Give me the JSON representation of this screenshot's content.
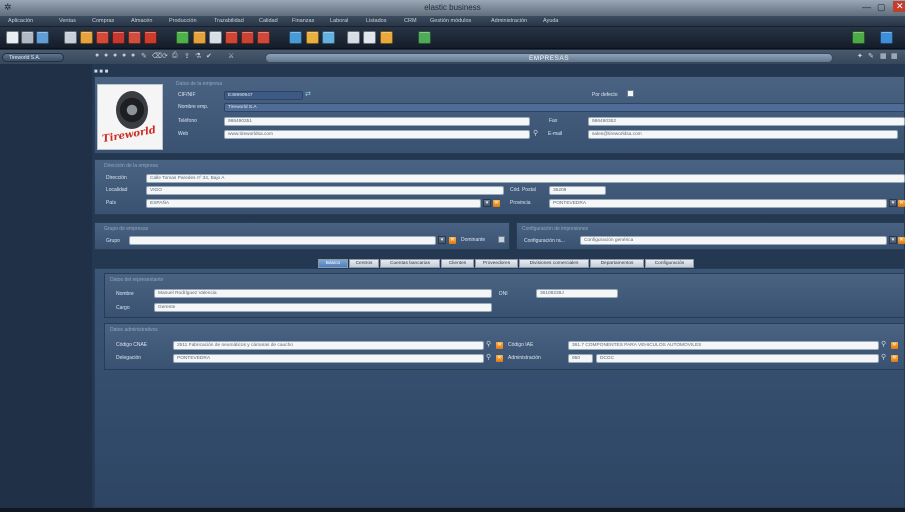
{
  "window": {
    "title": "elastic business"
  },
  "menu": [
    "Aplicación",
    "Ventas",
    "Compras",
    "Almacén",
    "Producción",
    "Trazabilidad",
    "Calidad",
    "Finanzas",
    "Laboral",
    "Listados",
    "CRM",
    "Gestión módulos",
    "Administración",
    "Ayuda"
  ],
  "open_tab": "Tireworld S.A.",
  "section_title": "EMPRESAS",
  "datos_empresa": {
    "section": "Datos de la empresa",
    "cif_label": "CIF/NIF",
    "cif": "E36990947",
    "nombre_label": "Nombre emp.",
    "nombre": "Tireworld S.A",
    "telefono_label": "Teléfono",
    "telefono": "986490351",
    "fax_label": "Fax",
    "fax": "986490352",
    "web_label": "Web",
    "web": "www.tireworldsa.com",
    "email_label": "E-mail",
    "email": "sales@tireworldsa.com",
    "por_defecto_label": "Por defecto"
  },
  "direccion": {
    "section": "Dirección de la empresa",
    "direccion_label": "Dirección",
    "direccion": "Calle Tomas Paredes nº 34, Bajo A",
    "localidad_label": "Localidad",
    "localidad": "VIGO",
    "cp_label": "Cód. Postal",
    "cp": "36208",
    "pais_label": "País",
    "pais": "ESPAÑA",
    "provincia_label": "Provincia",
    "provincia": "PONTEVEDRA"
  },
  "grupo": {
    "section": "Grupo de empresas",
    "grupo_label": "Grupo",
    "grupo": "",
    "dominante_label": "Dominante"
  },
  "impresiones": {
    "section": "Configuración de impresiones",
    "config_label": "Configuración ra...",
    "config": "Configuración genérica"
  },
  "tabs": [
    "Básico",
    "Centros",
    "Cuentas bancarias",
    "Clientes",
    "Proveedores",
    "Divisiones comerciales",
    "Departamentos",
    "Configuración"
  ],
  "representante": {
    "section": "Datos del representante",
    "nombre_label": "Nombre",
    "nombre": "Manuel Rodríguez Valencia",
    "dni_label": "DNI",
    "dni": "36108239J",
    "cargo_label": "Cargo",
    "cargo": "Gerente"
  },
  "administrativos": {
    "section": "Datos administrativos",
    "cnae_label": "Código CNAE",
    "cnae": "2511 Fabricación de neumáticos y cámaras de caucho",
    "iae_label": "Código IAE",
    "iae": "361.7 COMPONENTES PARA VEHICULOS AUTOMOVILES",
    "delegacion_label": "Delegación",
    "delegacion": "PONTEVEDRA",
    "administracion_label": "Administración",
    "administracion_code": "950",
    "administracion": "DCGC"
  },
  "logo_text": "Tireworld",
  "icons": [
    "search-icon",
    "close-icon",
    "chevron-down-icon",
    "gear-icon"
  ],
  "colors": {
    "accent": "#4f7fbe",
    "panel": "#3a5271",
    "warning": "#e07a10"
  }
}
